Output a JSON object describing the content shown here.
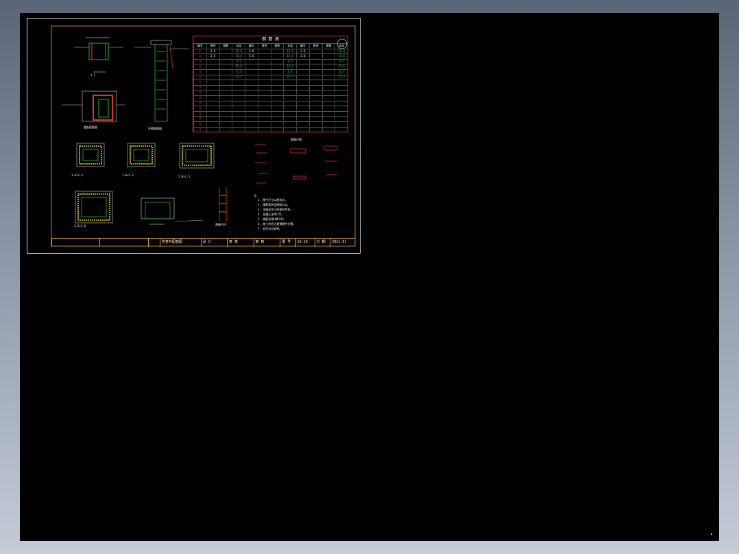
{
  "viewer": {
    "background_color": "#000000",
    "frame_color": "#d8d8d8",
    "accent_colors": {
      "green": "#2fe02f",
      "red": "#e03030",
      "white": "#ffffff",
      "orange": "#e0a040"
    }
  },
  "table": {
    "title": "钢 筋 表",
    "header": [
      "编号",
      "直径",
      "根数",
      "长度",
      "编号",
      "直径",
      "根数",
      "长度",
      "编号",
      "直径",
      "根数",
      "长度"
    ],
    "rows": [
      [
        "①",
        "2.6",
        "",
        "15.6",
        "2.6",
        "",
        "",
        "12.8",
        "2.6",
        "",
        "",
        "14.4"
      ],
      [
        "②",
        "2.6",
        "",
        "15.6",
        "2.6",
        "",
        "",
        "15.6",
        "2.6",
        "",
        "",
        "15.6"
      ],
      [
        "③",
        "",
        "",
        "4.5",
        "",
        "",
        "",
        "4.5",
        "",
        "",
        "",
        "4.5"
      ],
      [
        "④",
        "",
        "",
        "15.6",
        "",
        "",
        "",
        "15.6",
        "",
        "",
        "",
        "15.6"
      ],
      [
        "⑤",
        "",
        "",
        "4.5",
        "",
        "",
        "",
        "4.5",
        "",
        "",
        "",
        "4.5"
      ],
      [
        "⑥",
        "",
        "",
        "27.7",
        "",
        "",
        "",
        "27.7",
        "",
        "",
        "",
        "27.7"
      ],
      [
        "⑦",
        "",
        "",
        "",
        "",
        "",
        "",
        "",
        "",
        "",
        "",
        ""
      ],
      [
        "⑧",
        "",
        "",
        "",
        "",
        "",
        "",
        "",
        "",
        "",
        "",
        ""
      ],
      [
        "⑨",
        "",
        "",
        "",
        "",
        "",
        "",
        "",
        "",
        "",
        "",
        ""
      ],
      [
        "⑩",
        "",
        "",
        "",
        "",
        "",
        "",
        "",
        "",
        "",
        "",
        ""
      ],
      [
        "⑪",
        "",
        "",
        "",
        "",
        "",
        "",
        "",
        "",
        "",
        "",
        ""
      ],
      [
        "⑫",
        "",
        "",
        "",
        "",
        "",
        "",
        "",
        "",
        "",
        "",
        ""
      ],
      [
        "⑬",
        "",
        "",
        "",
        "",
        "",
        "",
        "",
        "",
        "",
        "",
        ""
      ],
      [
        "⑭",
        "",
        "",
        "",
        "",
        "",
        "",
        "",
        "",
        "",
        "",
        ""
      ],
      [
        "⑮",
        "",
        "",
        "",
        "",
        "",
        "",
        "",
        "",
        "",
        "",
        ""
      ],
      [
        "⑯",
        "",
        "",
        "",
        "",
        "",
        "",
        "",
        "",
        "",
        "",
        ""
      ]
    ]
  },
  "notes": {
    "heading": "注：",
    "lines": [
      "1. 图中尺寸以厘米计。",
      "2. 钢筋保护层厚度3cm。",
      "3. 本图适用于检查井井室。",
      "4. 混凝土采用C25。",
      "5. 钢筋采用HRB335。",
      "6. 施工时应注意预埋件位置。",
      "7. 其余详见说明。"
    ]
  },
  "sections": {
    "s1": "1-1",
    "s2": "井壁配筋图",
    "s3": "盖板配筋图",
    "s4": "钢筋详图",
    "p1": "1.6×1.2",
    "p2": "1.6×1.2",
    "p3": "2.0×1.5",
    "p4": "2.5×2.0",
    "ladder": "爬梯大样"
  },
  "titleblock": {
    "cells": [
      "",
      "",
      "",
      "检查井配筋图",
      "设 计",
      "复 核",
      "审 核",
      "图 号",
      "SJ-10",
      "日 期",
      "2011.01"
    ]
  }
}
